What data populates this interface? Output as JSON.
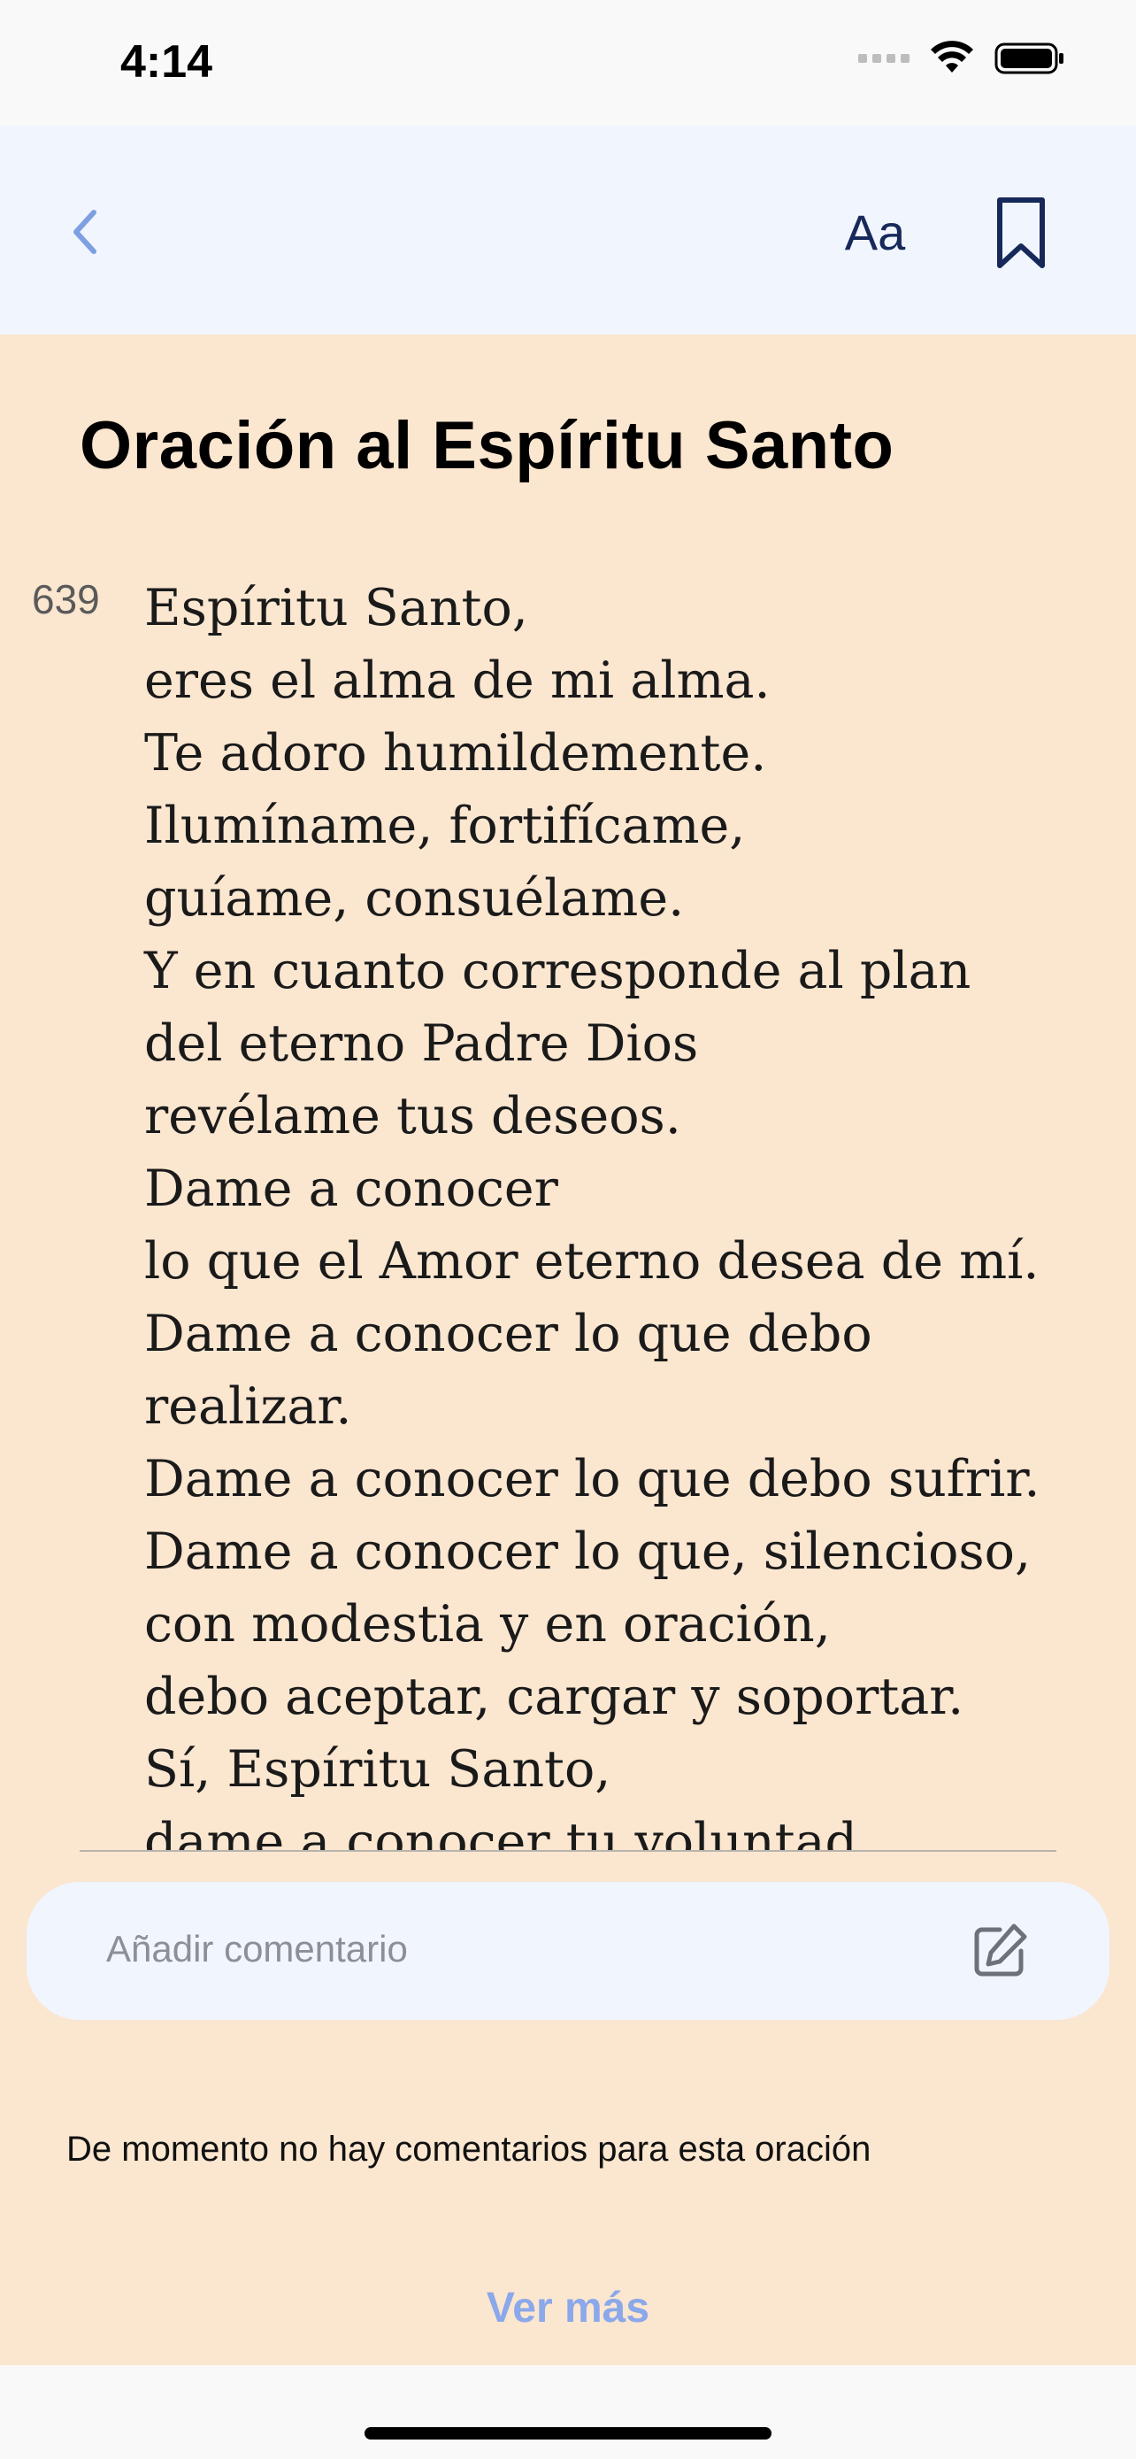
{
  "status_bar": {
    "time": "4:14"
  },
  "nav": {
    "font_button_label": "Aa"
  },
  "prayer": {
    "title": "Oración al Espíritu Santo",
    "number": "639",
    "lines": [
      "Espíritu Santo,",
      "eres el alma de mi alma.",
      "Te adoro humildemente.",
      "Ilumíname, fortifícame,",
      "guíame, consuélame.",
      "Y en cuanto corresponde al plan",
      "del eterno Padre Dios",
      "revélame tus deseos.",
      "Dame a conocer",
      "lo que el Amor eterno desea de mí.",
      "Dame a conocer lo que debo",
      "realizar.",
      "Dame a conocer lo que debo sufrir.",
      "Dame a conocer lo que, silencioso,",
      "con modestia y en oración,",
      "debo aceptar, cargar y soportar.",
      "Sí, Espíritu Santo,",
      "dame a conocer tu voluntad"
    ]
  },
  "comments": {
    "placeholder": "Añadir comentario",
    "empty_message": "De momento no hay comentarios para esta oración",
    "see_more_label": "Ver más"
  },
  "colors": {
    "background": "#fbe6d0",
    "nav_background": "#f1f5fe",
    "accent": "#8aa8ea",
    "nav_icon": "#16295a"
  }
}
